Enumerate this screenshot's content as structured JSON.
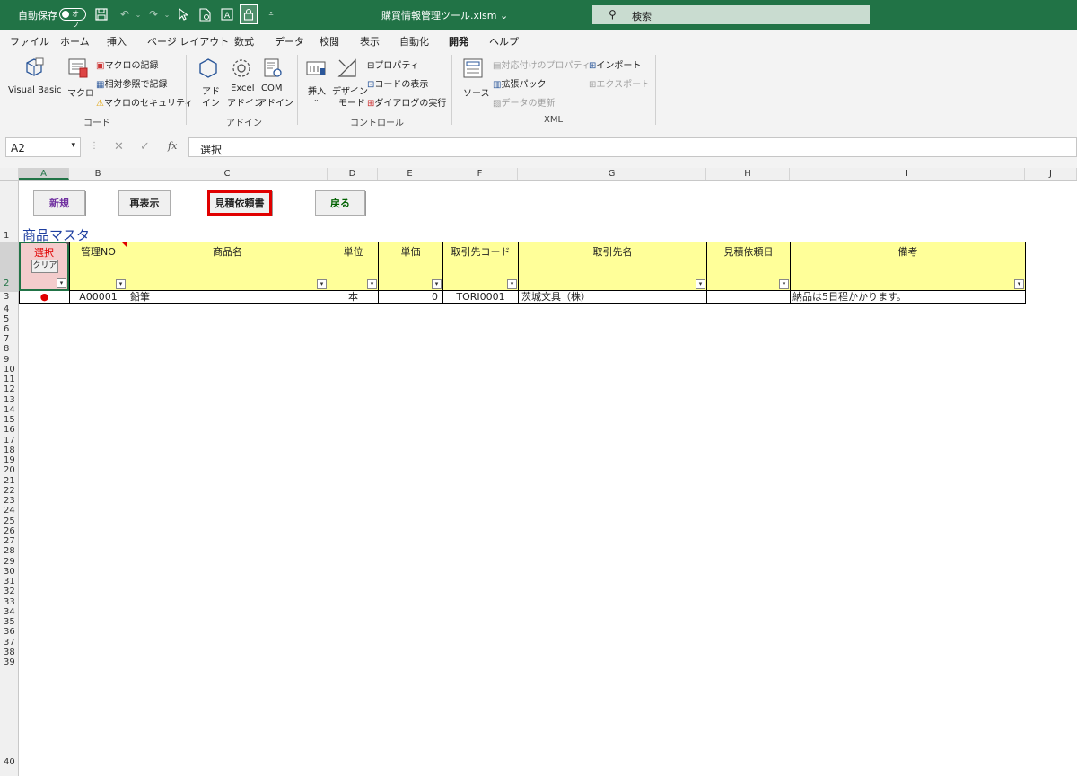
{
  "titlebar": {
    "autosave_label": "自動保存",
    "autosave_state": "オフ",
    "filename": "購買情報管理ツール.xlsm ⌄",
    "search_placeholder": "検索"
  },
  "menu": [
    "ファイル",
    "ホーム",
    "挿入",
    "ページ レイアウト",
    "数式",
    "データ",
    "校閲",
    "表示",
    "自動化",
    "開発",
    "ヘルプ"
  ],
  "menu_active": "開発",
  "ribbon": {
    "code": {
      "visual_basic": "Visual Basic",
      "macro": "マクロ",
      "record_macro": "マクロの記録",
      "relative_ref": "相対参照で記録",
      "macro_security": "マクロのセキュリティ",
      "group": "コード"
    },
    "addins": {
      "addin_1": "アド",
      "addin_2": "イン",
      "excel_addin_1": "Excel",
      "excel_addin_2": "アドイン",
      "com_addin_1": "COM",
      "com_addin_2": "アドイン",
      "group": "アドイン"
    },
    "controls": {
      "insert": "挿入",
      "design_mode_1": "デザイン",
      "design_mode_2": "モード",
      "properties": "プロパティ",
      "view_code": "コードの表示",
      "run_dialog": "ダイアログの実行",
      "group": "コントロール"
    },
    "xml": {
      "source": "ソース",
      "map_properties": "対応付けのプロパティ",
      "expansion_packs": "拡張パック",
      "refresh_data": "データの更新",
      "import": "インポート",
      "export": "エクスポート",
      "group": "XML"
    }
  },
  "formula_bar": {
    "name_box": "A2",
    "content": "選択",
    "fx": "fx"
  },
  "columns": [
    "A",
    "B",
    "C",
    "D",
    "E",
    "F",
    "G",
    "H",
    "I",
    "J"
  ],
  "rows": [
    "1",
    "2",
    "3",
    "4",
    "5",
    "6",
    "7",
    "8",
    "9",
    "10",
    "11",
    "12",
    "13",
    "14",
    "15",
    "16",
    "17",
    "18",
    "19",
    "20",
    "21",
    "22",
    "23",
    "24",
    "25",
    "26",
    "27",
    "28",
    "29",
    "30",
    "31",
    "32",
    "33",
    "34",
    "35",
    "36",
    "37",
    "38",
    "39",
    "40"
  ],
  "sheet": {
    "buttons": {
      "new": "新規",
      "redisplay": "再表示",
      "quote_request": "見積依頼書",
      "back": "戻る"
    },
    "title": "商品マスタ",
    "headers": {
      "select": "選択",
      "clear": "クリア",
      "mgmt_no": "管理NO",
      "product_name": "商品名",
      "unit": "単位",
      "unit_price": "単価",
      "supplier_code": "取引先コード",
      "supplier_name": "取引先名",
      "quote_date": "見積依頼日",
      "notes": "備考"
    },
    "row3": {
      "select": "●",
      "mgmt_no": "A00001",
      "product_name": "鉛筆",
      "unit": "本",
      "unit_price": "0",
      "supplier_code": "TORI0001",
      "supplier_name": "茨城文具（株）",
      "quote_date": "",
      "notes": "納品は5日程かかります。"
    }
  },
  "colors": {
    "excel_green": "#217346",
    "header_yellow": "#ffff99",
    "select_red": "#ff0000"
  }
}
